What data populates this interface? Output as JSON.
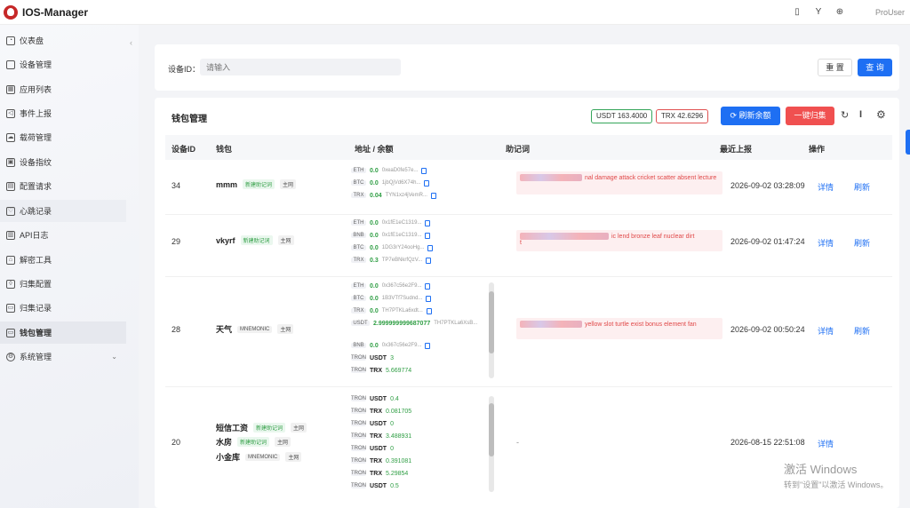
{
  "app": {
    "title": "IOS-Manager",
    "user": "ProUser"
  },
  "topbar": {
    "icons": [
      "phone-icon",
      "branch-icon",
      "globe-icon"
    ]
  },
  "sidebar": {
    "items": [
      {
        "label": "仪表盘",
        "icon": "dashboard-icon"
      },
      {
        "label": "设备管理",
        "icon": "phone-icon"
      },
      {
        "label": "应用列表",
        "icon": "grid-icon"
      },
      {
        "label": "事件上报",
        "icon": "send-icon"
      },
      {
        "label": "载荷管理",
        "icon": "cloud-icon"
      },
      {
        "label": "设备指纹",
        "icon": "fingerprint-icon"
      },
      {
        "label": "配置请求",
        "icon": "config-icon"
      },
      {
        "label": "心跳记录",
        "icon": "heart-icon"
      },
      {
        "label": "API日志",
        "icon": "api-icon"
      },
      {
        "label": "解密工具",
        "icon": "lock-icon"
      },
      {
        "label": "归集配置",
        "icon": "shield-icon"
      },
      {
        "label": "归集记录",
        "icon": "record-icon"
      },
      {
        "label": "钱包管理",
        "icon": "wallet-icon"
      },
      {
        "label": "系统管理",
        "icon": "gear-icon"
      }
    ]
  },
  "search": {
    "label": "设备ID：",
    "placeholder": "请输入",
    "reset": "重 置",
    "query": "查 询"
  },
  "wallet": {
    "title": "钱包管理",
    "usdt_total": "USDT 163.4000",
    "trx_total": "TRX 42.6296",
    "refresh_btn": "刷新余额",
    "collect_btn": "一键归集",
    "columns": [
      "设备ID",
      "钱包",
      "地址 / 余额",
      "助记词",
      "最近上报",
      "操作"
    ],
    "op_detail": "详情",
    "op_refresh": "刷新",
    "rows": [
      {
        "id": "34",
        "wallets": [
          {
            "name": "mmm",
            "badge": "新建助记词",
            "tag": "主网"
          }
        ],
        "addresses": [
          {
            "chain": "ETH",
            "bal": "0.0",
            "hash": "0xeaD0fe57e..."
          },
          {
            "chain": "BTC",
            "bal": "0.0",
            "hash": "1jbQjVd6X74h..."
          },
          {
            "chain": "TRX",
            "bal": "0.04",
            "hash": "TYN1xz4jVemR..."
          }
        ],
        "mnemonic": "nal damage attack cricket scatter absent lecture",
        "time": "2026-09-02 03:28:09"
      },
      {
        "id": "29",
        "wallets": [
          {
            "name": "vkyrf",
            "badge": "新建助记词",
            "tag": "主网"
          }
        ],
        "addresses": [
          {
            "chain": "ETH",
            "bal": "0.0",
            "hash": "0x1fE1eC1319..."
          },
          {
            "chain": "BNB",
            "bal": "0.0",
            "hash": "0x1fE1eC1319..."
          },
          {
            "chain": "BTC",
            "bal": "0.0",
            "hash": "1DG3rY24ooHg..."
          },
          {
            "chain": "TRX",
            "bal": "0.3",
            "hash": "TP7eBNkrfQzV..."
          }
        ],
        "mnemonic": "ic lend bronze leaf nuclear dirt",
        "mnemonic_tail": "t",
        "time": "2026-09-02 01:47:24"
      },
      {
        "id": "28",
        "wallets": [
          {
            "name": "天气",
            "badge": "MNEMONIC",
            "tag": "主网"
          }
        ],
        "addresses": [
          {
            "chain": "ETH",
            "bal": "0.0",
            "hash": "0x367c56e2F9..."
          },
          {
            "chain": "BTC",
            "bal": "0.0",
            "hash": "1B3VTf7Sudnd..."
          },
          {
            "chain": "TRX",
            "bal": "0.0",
            "hash": "TH7PTKLa6xdt..."
          },
          {
            "chain": "USDT",
            "bal": "2.999999999687077",
            "hash": "TH7PTKLa6XsB..."
          },
          {
            "chain": "BNB",
            "bal": "0.0",
            "hash": "0x367c56e2F9..."
          }
        ],
        "tokens": [
          {
            "chain": "TRON",
            "tok": "USDT",
            "amt": "3"
          },
          {
            "chain": "TRON",
            "tok": "TRX",
            "amt": "5.669774"
          }
        ],
        "mnemonic": "yellow slot turtle exist bonus element fan",
        "time": "2026-09-02 00:50:24"
      },
      {
        "id": "20",
        "wallets": [
          {
            "name": "短信工资",
            "badge": "新建助记词",
            "tag": "主网"
          },
          {
            "name": "水房",
            "badge": "新建助记词",
            "tag": "主网"
          },
          {
            "name": "小金库",
            "badge": "MNEMONIC",
            "tag": "主网"
          }
        ],
        "tokens": [
          {
            "chain": "TRON",
            "tok": "USDT",
            "amt": "0.4"
          },
          {
            "chain": "TRON",
            "tok": "TRX",
            "amt": "0.081705"
          },
          {
            "chain": "TRON",
            "tok": "USDT",
            "amt": "0"
          },
          {
            "chain": "TRON",
            "tok": "TRX",
            "amt": "3.488931"
          },
          {
            "chain": "TRON",
            "tok": "USDT",
            "amt": "0"
          },
          {
            "chain": "TRON",
            "tok": "TRX",
            "amt": "0.391081"
          },
          {
            "chain": "TRON",
            "tok": "TRX",
            "amt": "5.29854"
          },
          {
            "chain": "TRON",
            "tok": "USDT",
            "amt": "0.5"
          }
        ],
        "mnemonic": "-",
        "time": "2026-08-15 22:51:08"
      }
    ]
  },
  "watermark": {
    "line1": "激活 Windows",
    "line2": "转到\"设置\"以激活 Windows。"
  }
}
